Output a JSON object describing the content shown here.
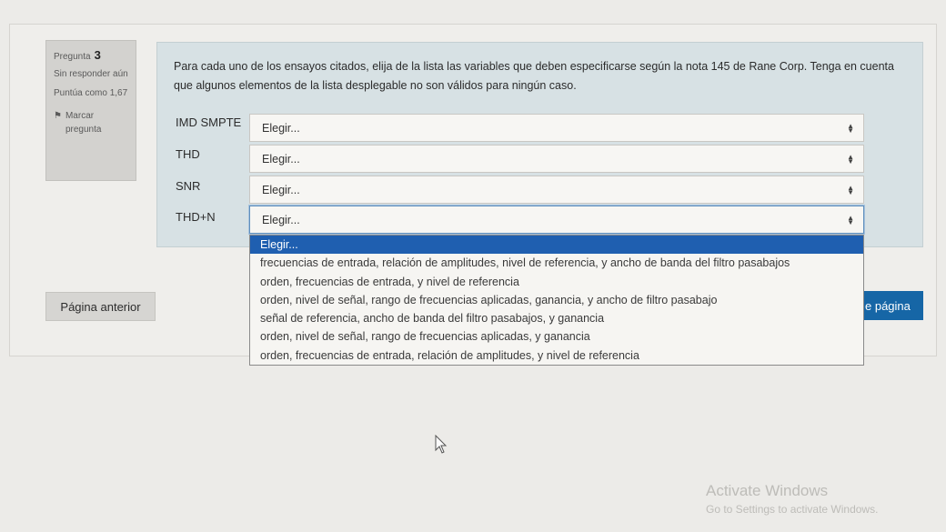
{
  "question": {
    "label": "Pregunta",
    "number": "3",
    "status": "Sin responder aún",
    "score": "Puntúa como 1,67",
    "flag_label": "Marcar pregunta",
    "text": "Para cada uno de los ensayos citados, elija de la lista las variables que deben especificarse según la nota 145 de Rane Corp. Tenga en cuenta que algunos elementos de la lista desplegable no son válidos para ningún caso."
  },
  "rows": [
    {
      "label": "IMD SMPTE",
      "value": "Elegir..."
    },
    {
      "label": "THD",
      "value": "Elegir..."
    },
    {
      "label": "SNR",
      "value": "Elegir..."
    },
    {
      "label": "THD+N",
      "value": "Elegir..."
    }
  ],
  "dropdown_options": [
    "Elegir...",
    "frecuencias de entrada, relación de amplitudes, nivel de referencia, y ancho de banda del filtro pasabajos",
    "orden, frecuencias de entrada, y nivel de referencia",
    "orden, nivel de señal, rango de frecuencias aplicadas, ganancia, y ancho de filtro pasabajo",
    "señal de referencia, ancho de banda del filtro pasabajos, y ganancia",
    "orden, nivel de señal, rango de frecuencias aplicadas, y ganancia",
    "orden, frecuencias de entrada, relación de amplitudes, y nivel de referencia"
  ],
  "nav": {
    "prev_label": "Página anterior",
    "next_label_visible": "e página"
  },
  "watermark": {
    "title": "Activate Windows",
    "subtitle": "Go to Settings to activate Windows."
  },
  "icons": {
    "flag": "flag-icon",
    "select_caret": "updown-caret-icon",
    "cursor": "mouse-pointer-icon"
  },
  "colors": {
    "accent": "#1666a6",
    "selected_option": "#1f5fb0",
    "content_bg": "#d7e1e4"
  }
}
